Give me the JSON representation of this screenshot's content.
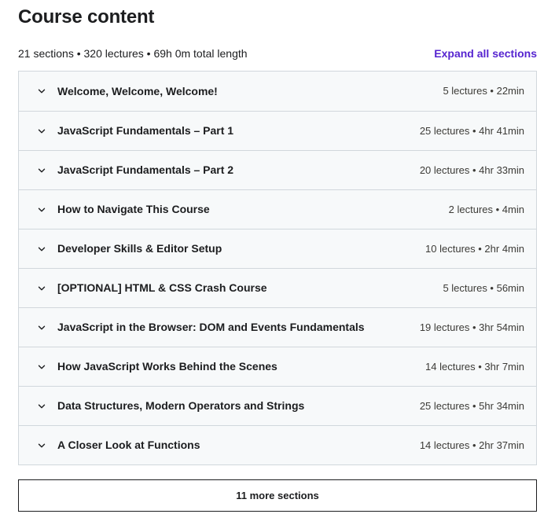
{
  "header": {
    "title": "Course content",
    "summary": "21 sections • 320 lectures • 69h 0m total length",
    "expand_all_label": "Expand all sections",
    "accent_color": "#5624d0"
  },
  "icons": {
    "chevron_down": "chevron-down-icon"
  },
  "sections": [
    {
      "title": "Welcome, Welcome, Welcome!",
      "meta": "5 lectures • 22min"
    },
    {
      "title": "JavaScript Fundamentals – Part 1",
      "meta": "25 lectures • 4hr 41min"
    },
    {
      "title": "JavaScript Fundamentals – Part 2",
      "meta": "20 lectures • 4hr 33min"
    },
    {
      "title": "How to Navigate This Course",
      "meta": "2 lectures • 4min"
    },
    {
      "title": "Developer Skills & Editor Setup",
      "meta": "10 lectures • 2hr 4min"
    },
    {
      "title": "[OPTIONAL] HTML & CSS Crash Course",
      "meta": "5 lectures • 56min"
    },
    {
      "title": "JavaScript in the Browser: DOM and Events Fundamentals",
      "meta": "19 lectures • 3hr 54min"
    },
    {
      "title": "How JavaScript Works Behind the Scenes",
      "meta": "14 lectures • 3hr 7min"
    },
    {
      "title": "Data Structures, Modern Operators and Strings",
      "meta": "25 lectures • 5hr 34min"
    },
    {
      "title": "A Closer Look at Functions",
      "meta": "14 lectures • 2hr 37min"
    }
  ],
  "footer": {
    "more_sections_label": "11 more sections"
  }
}
